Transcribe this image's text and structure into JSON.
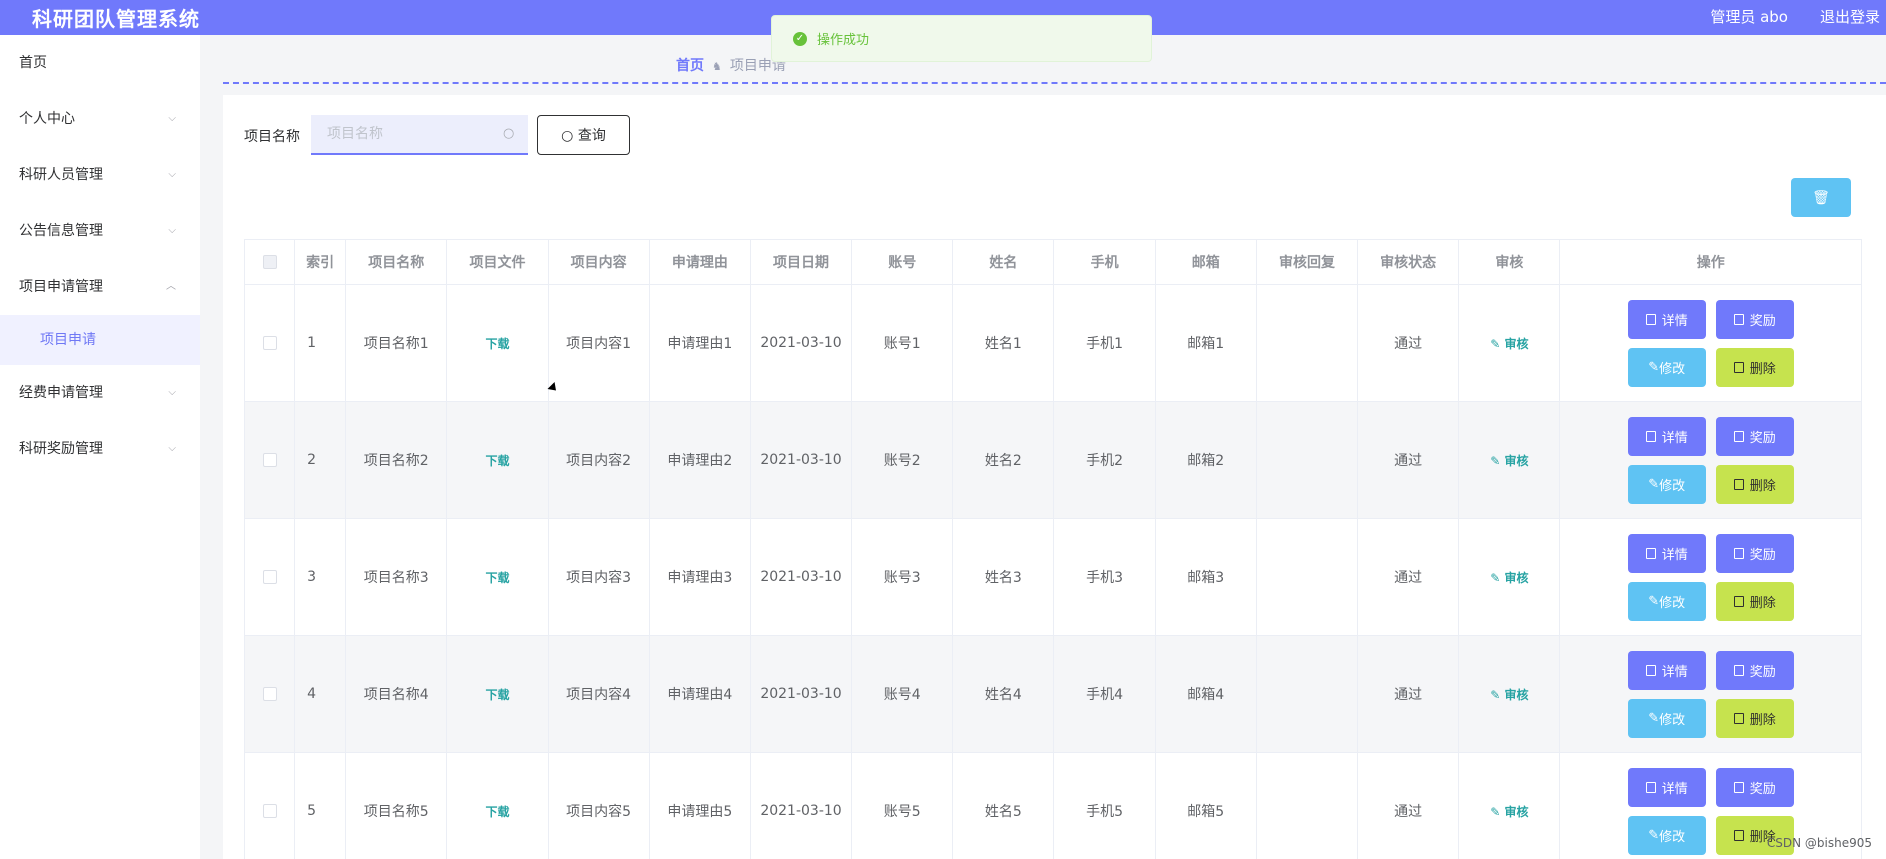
{
  "topbar": {
    "title": "科研团队管理系统",
    "user": "管理员 abo",
    "logout": "退出登录"
  },
  "toast": {
    "message": "操作成功"
  },
  "sidebar": {
    "items": [
      {
        "label": "首页"
      },
      {
        "label": "个人中心"
      },
      {
        "label": "科研人员管理"
      },
      {
        "label": "公告信息管理"
      },
      {
        "label": "项目申请管理"
      },
      {
        "label": "经费申请管理"
      },
      {
        "label": "科研奖励管理"
      }
    ],
    "subitem": "项目申请"
  },
  "breadcrumb": {
    "home": "首页",
    "current": "项目申请"
  },
  "search": {
    "label": "项目名称",
    "placeholder": "项目名称",
    "button": "查询"
  },
  "table": {
    "headers": [
      "索引",
      "项目名称",
      "项目文件",
      "项目内容",
      "申请理由",
      "项目日期",
      "账号",
      "姓名",
      "手机",
      "邮箱",
      "审核回复",
      "审核状态",
      "审核",
      "操作"
    ],
    "rows": [
      {
        "index": "1",
        "name": "项目名称1",
        "file": "下载",
        "content": "项目内容1",
        "reason": "申请理由1",
        "date": "2021-03-10",
        "account": "账号1",
        "person": "姓名1",
        "phone": "手机1",
        "email": "邮箱1",
        "reply": "",
        "status": "通过",
        "review": "审核"
      },
      {
        "index": "2",
        "name": "项目名称2",
        "file": "下载",
        "content": "项目内容2",
        "reason": "申请理由2",
        "date": "2021-03-10",
        "account": "账号2",
        "person": "姓名2",
        "phone": "手机2",
        "email": "邮箱2",
        "reply": "",
        "status": "通过",
        "review": "审核"
      },
      {
        "index": "3",
        "name": "项目名称3",
        "file": "下载",
        "content": "项目内容3",
        "reason": "申请理由3",
        "date": "2021-03-10",
        "account": "账号3",
        "person": "姓名3",
        "phone": "手机3",
        "email": "邮箱3",
        "reply": "",
        "status": "通过",
        "review": "审核"
      },
      {
        "index": "4",
        "name": "项目名称4",
        "file": "下载",
        "content": "项目内容4",
        "reason": "申请理由4",
        "date": "2021-03-10",
        "account": "账号4",
        "person": "姓名4",
        "phone": "手机4",
        "email": "邮箱4",
        "reply": "",
        "status": "通过",
        "review": "审核"
      },
      {
        "index": "5",
        "name": "项目名称5",
        "file": "下载",
        "content": "项目内容5",
        "reason": "申请理由5",
        "date": "2021-03-10",
        "account": "账号5",
        "person": "姓名5",
        "phone": "手机5",
        "email": "邮箱5",
        "reply": "",
        "status": "通过",
        "review": "审核"
      }
    ],
    "actions": {
      "detail": "详情",
      "award": "奖励",
      "edit": "修改",
      "delete": "删除"
    }
  },
  "watermark": "CSDN @bishe905",
  "colors": {
    "primary": "#7079fb",
    "info": "#5fc3f3",
    "danger_like": "#c6e34e",
    "success": "#67c23a",
    "link": "#27a3a3"
  }
}
